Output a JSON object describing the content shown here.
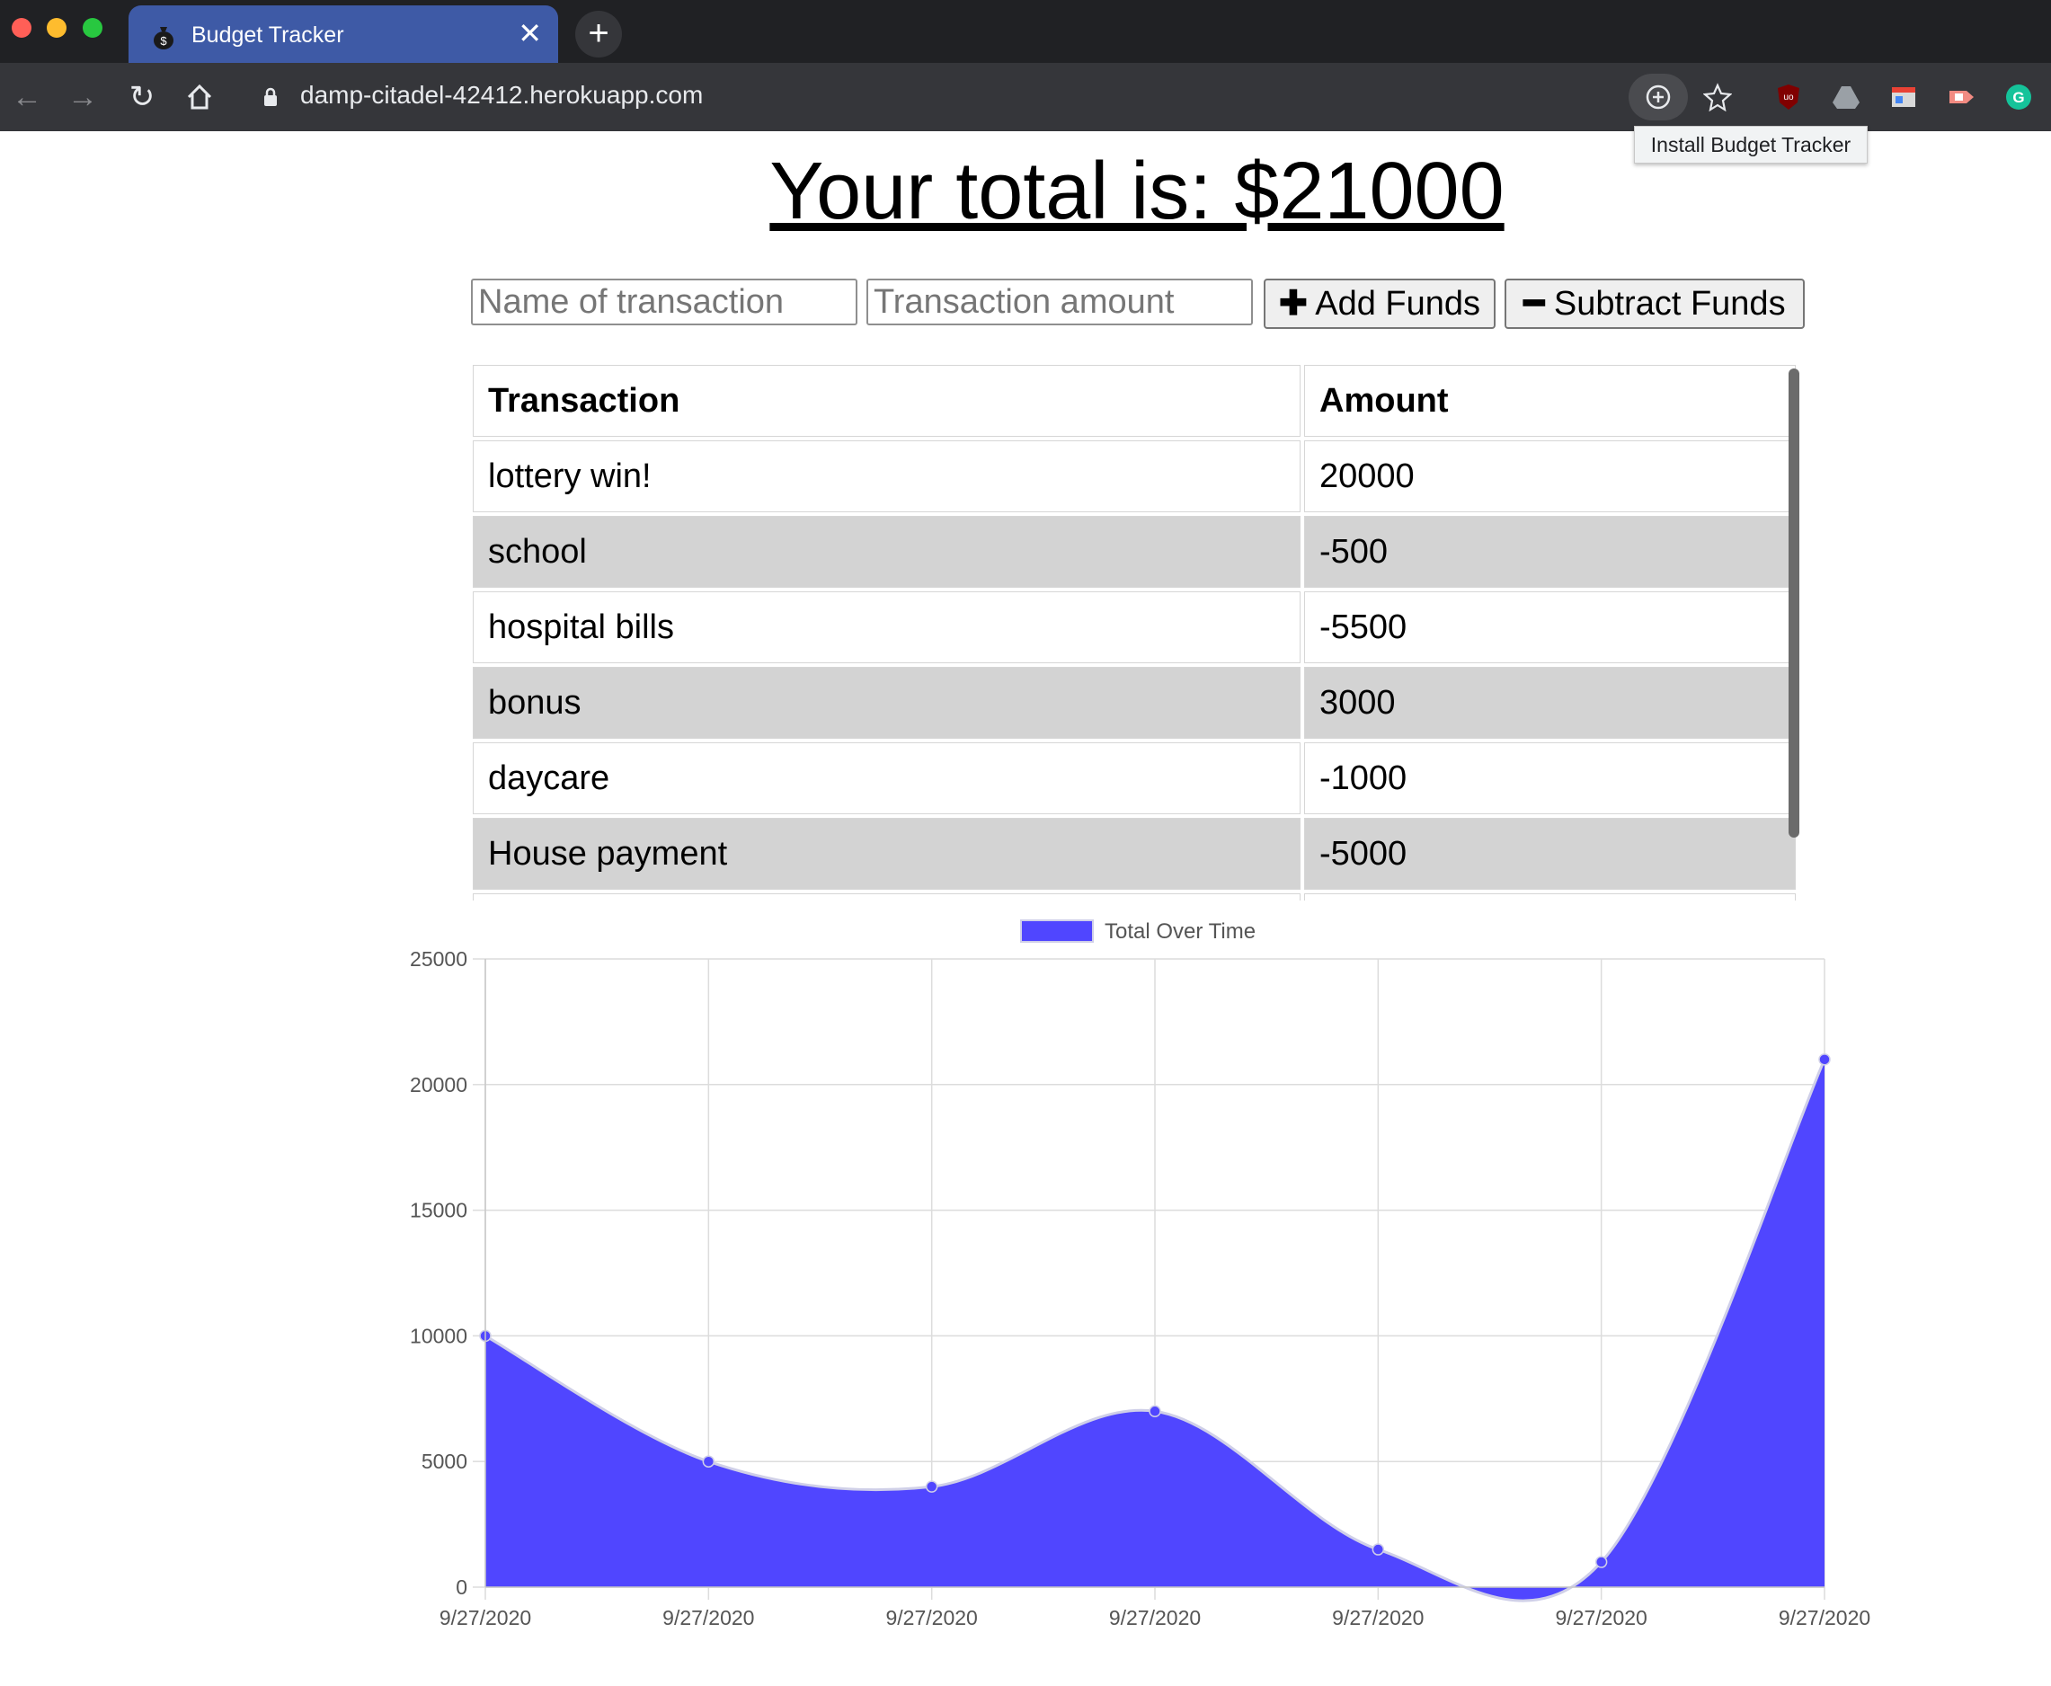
{
  "browser": {
    "tab_title": "Budget Tracker",
    "tab_close": "✕",
    "new_tab": "+",
    "url": "damp-citadel-42412.herokuapp.com",
    "tooltip": "Install Budget Tracker"
  },
  "page": {
    "total_text": "Your total is: $21000",
    "name_placeholder": "Name of transaction",
    "amount_placeholder": "Transaction amount",
    "add_icon": "✚",
    "add_label": "Add Funds",
    "subtract_icon": "━",
    "subtract_label": "Subtract Funds"
  },
  "table": {
    "headers": [
      "Transaction",
      "Amount"
    ],
    "rows": [
      {
        "name": "lottery win!",
        "amount": "20000"
      },
      {
        "name": "school",
        "amount": "-500"
      },
      {
        "name": "hospital bills",
        "amount": "-5500"
      },
      {
        "name": "bonus",
        "amount": "3000"
      },
      {
        "name": "daycare",
        "amount": "-1000"
      },
      {
        "name": "House payment",
        "amount": "-5000"
      }
    ]
  },
  "chart_data": {
    "type": "area",
    "x": [
      "9/27/2020",
      "9/27/2020",
      "9/27/2020",
      "9/27/2020",
      "9/27/2020",
      "9/27/2020",
      "9/27/2020"
    ],
    "series": [
      {
        "name": "Total Over Time",
        "values": [
          10000,
          5000,
          4000,
          7000,
          1500,
          1000,
          21000
        ],
        "color": "#5046ff"
      }
    ],
    "y_ticks": [
      "0",
      "5000",
      "10000",
      "15000",
      "20000",
      "25000"
    ],
    "ylim": [
      0,
      25000
    ],
    "grid": true,
    "legend": "top-center"
  }
}
